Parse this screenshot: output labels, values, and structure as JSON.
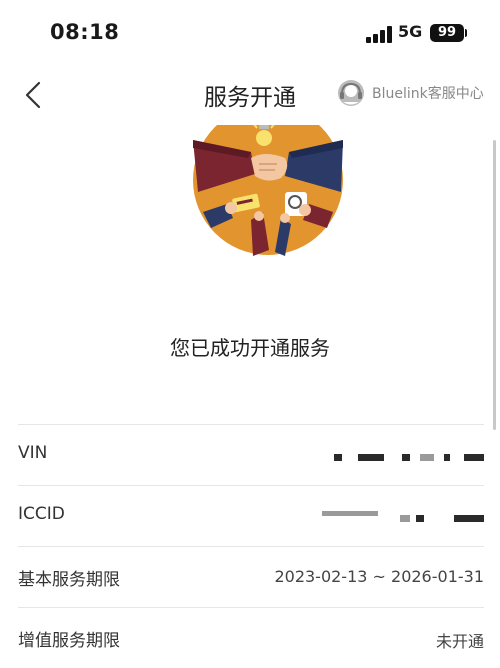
{
  "status_bar": {
    "time": "08:18",
    "network": "5G",
    "battery": "99"
  },
  "nav": {
    "title": "服务开通",
    "customer_service": "Bluelink客服中心"
  },
  "message": "您已成功开通服务",
  "info": [
    {
      "label": "VIN",
      "value": ""
    },
    {
      "label": "ICCID",
      "value": ""
    },
    {
      "label": "基本服务期限",
      "value": "2023-02-13 ~ 2026-01-31"
    },
    {
      "label": "增值服务期限",
      "value": "未开通"
    }
  ],
  "colors": {
    "hero_bg": "#E2952F",
    "divider": "#e6e6e6",
    "accent": "#222222"
  }
}
